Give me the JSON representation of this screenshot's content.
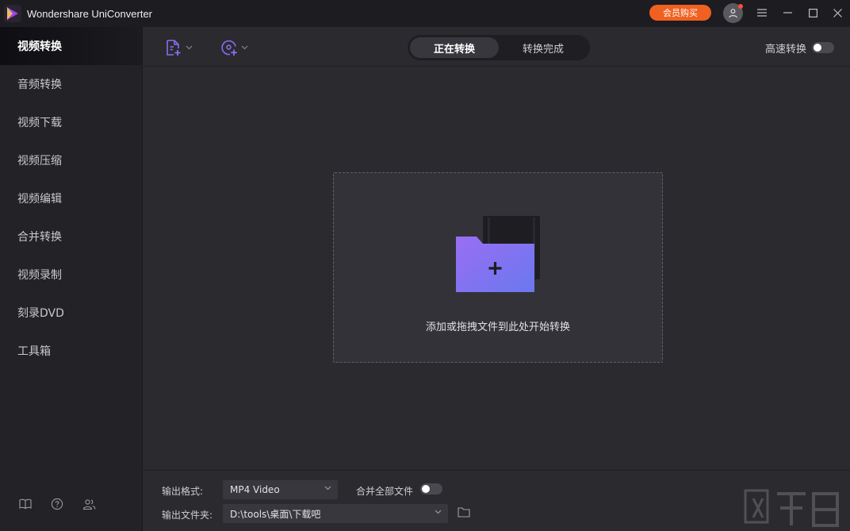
{
  "app": {
    "title": "Wondershare UniConverter",
    "buy_label": "会员购买"
  },
  "sidebar": {
    "items": [
      {
        "label": "视频转换",
        "active": true
      },
      {
        "label": "音频转换"
      },
      {
        "label": "视频下载"
      },
      {
        "label": "视频压缩"
      },
      {
        "label": "视频编辑"
      },
      {
        "label": "合并转换"
      },
      {
        "label": "视频录制"
      },
      {
        "label": "刻录DVD"
      },
      {
        "label": "工具箱"
      }
    ],
    "bottom_icons": [
      "book-icon",
      "help-icon",
      "users-icon"
    ]
  },
  "toolbar": {
    "add_file_icon": "add-file-icon",
    "add_disc_icon": "add-disc-icon",
    "tabs": [
      {
        "label": "正在转换",
        "active": true
      },
      {
        "label": "转换完成"
      }
    ],
    "speed_label": "高速转换"
  },
  "dropzone": {
    "text": "添加或拖拽文件到此处开始转换"
  },
  "bottombar": {
    "format_label": "输出格式:",
    "format_value": "MP4 Video",
    "merge_label": "合并全部文件",
    "folder_label": "输出文件夹:",
    "folder_value": "D:\\tools\\桌面\\下载吧"
  },
  "colors": {
    "accent": "#f06020",
    "folder_purple": "#8a6cf0",
    "background": "#2b2a2f",
    "sidebar": "#232227"
  }
}
